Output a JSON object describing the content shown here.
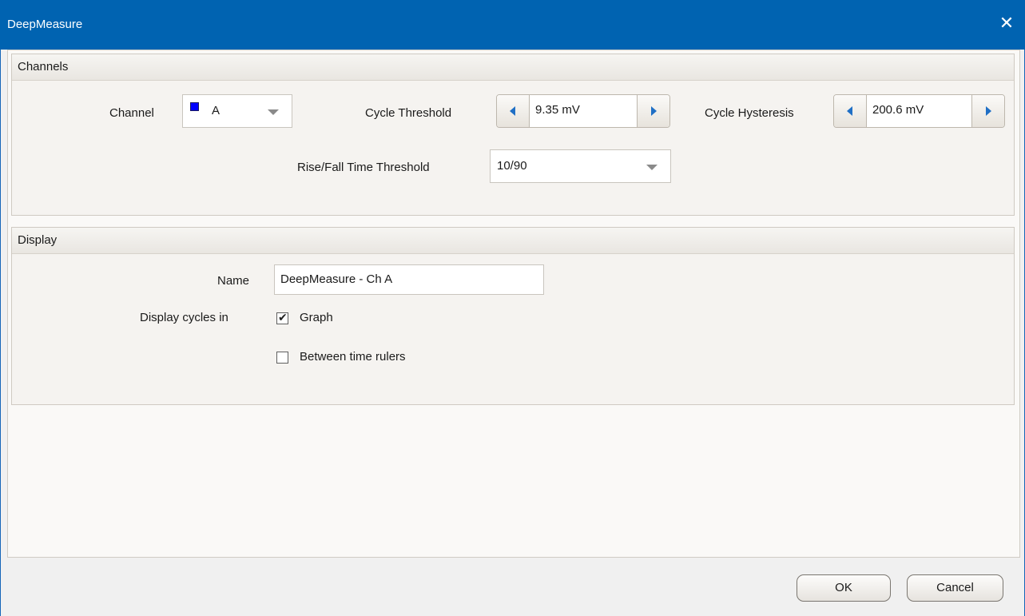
{
  "window": {
    "title": "DeepMeasure",
    "close_glyph": "✕"
  },
  "channels": {
    "header": "Channels",
    "channel_label": "Channel",
    "channel_value": "A",
    "channel_color": "#0000ff",
    "cycle_threshold_label": "Cycle Threshold",
    "cycle_threshold_value": "9.35 mV",
    "cycle_hysteresis_label": "Cycle Hysteresis",
    "cycle_hysteresis_value": "200.6 mV",
    "rise_fall_label": "Rise/Fall Time Threshold",
    "rise_fall_value": "10/90"
  },
  "display": {
    "header": "Display",
    "name_label": "Name",
    "name_value": "DeepMeasure - Ch A",
    "display_cycles_label": "Display cycles in",
    "graph_label": "Graph",
    "graph_checked": true,
    "between_rulers_label": "Between time rulers",
    "between_rulers_checked": false
  },
  "footer": {
    "ok_label": "OK",
    "cancel_label": "Cancel"
  }
}
